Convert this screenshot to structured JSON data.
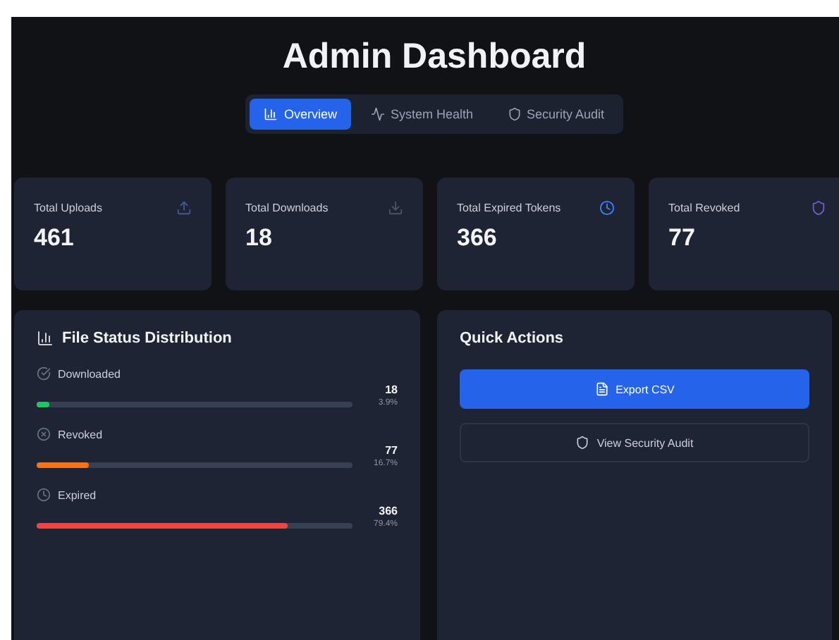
{
  "title": "Admin Dashboard",
  "tabs": [
    {
      "label": "Overview",
      "kind": "chart",
      "selected": true
    },
    {
      "label": "System Health",
      "kind": "activity",
      "selected": false
    },
    {
      "label": "Security Audit",
      "kind": "shield",
      "selected": false
    }
  ],
  "stats": [
    {
      "label": "Total Uploads",
      "value": "461",
      "kind": "upload",
      "color": "#3b5b9a"
    },
    {
      "label": "Total Downloads",
      "value": "18",
      "kind": "download",
      "color": "#4b5563"
    },
    {
      "label": "Total Expired Tokens",
      "value": "366",
      "kind": "clock",
      "color": "#3b82f6"
    },
    {
      "label": "Total Revoked",
      "value": "77",
      "kind": "shield",
      "color": "#6d5fc7"
    }
  ],
  "distribution": {
    "title": "File Status Distribution",
    "items": [
      {
        "label": "Downloaded",
        "kind": "check",
        "count": "18",
        "percent": "3.9%",
        "level": 0.039,
        "color": "#22c55e"
      },
      {
        "label": "Revoked",
        "kind": "x",
        "count": "77",
        "percent": "16.7%",
        "level": 0.167,
        "color": "#f97316"
      },
      {
        "label": "Expired",
        "kind": "clock",
        "count": "366",
        "percent": "79.4%",
        "level": 0.794,
        "color": "#ef4444"
      }
    ]
  },
  "quick_actions": {
    "title": "Quick Actions",
    "buttons": [
      {
        "label": "Export CSV",
        "kind": "primary"
      },
      {
        "label": "View Security Audit",
        "kind": "outline"
      }
    ]
  }
}
